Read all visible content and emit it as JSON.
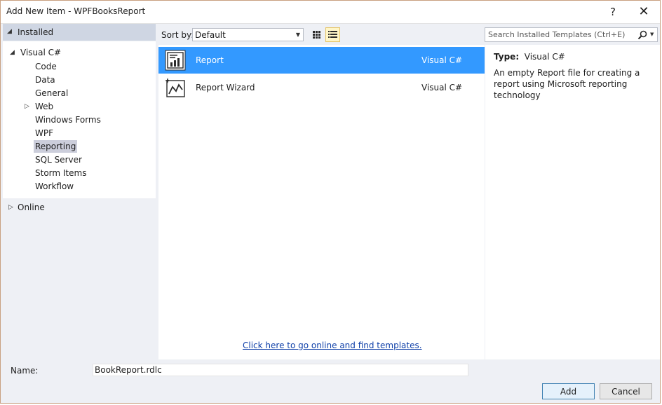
{
  "window": {
    "title": "Add New Item - WPFBooksReport",
    "help_glyph": "?",
    "close_glyph": "✕"
  },
  "left_tree": {
    "installed": {
      "label": "Installed",
      "arrow": "◢"
    },
    "visual_csharp": {
      "label": "Visual C#",
      "arrow": "◢"
    },
    "items": [
      {
        "label": "Code"
      },
      {
        "label": "Data"
      },
      {
        "label": "General"
      },
      {
        "label": "Web",
        "arrow": "▷"
      },
      {
        "label": "Windows Forms"
      },
      {
        "label": "WPF"
      },
      {
        "label": "Reporting",
        "selected": true
      },
      {
        "label": "SQL Server"
      },
      {
        "label": "Storm Items"
      },
      {
        "label": "Workflow"
      }
    ],
    "online": {
      "label": "Online",
      "arrow": "▷"
    }
  },
  "toolbar": {
    "sort_label": "Sort by:",
    "sort_value": "Default",
    "sort_caret": "▼",
    "search_placeholder": "Search Installed Templates (Ctrl+E)",
    "search_caret": "▼",
    "view_mode": "list"
  },
  "templates": [
    {
      "name": "Report",
      "language": "Visual C#",
      "selected": true,
      "icon": "report-icon"
    },
    {
      "name": "Report Wizard",
      "language": "Visual C#",
      "selected": false,
      "icon": "report-wizard-icon"
    }
  ],
  "online_link": "Click here to go online and find templates.",
  "details": {
    "type_label": "Type:",
    "type_value": "Visual C#",
    "description": "An empty Report file for creating a report using Microsoft reporting technology"
  },
  "bottom": {
    "name_label": "Name:",
    "name_value": "BookReport.rdlc",
    "add_label": "Add",
    "cancel_label": "Cancel"
  },
  "colors": {
    "selection": "#3399ff",
    "link": "#0e3fa8",
    "header": "#cfd6e3",
    "window_bg": "#eef0f5"
  }
}
